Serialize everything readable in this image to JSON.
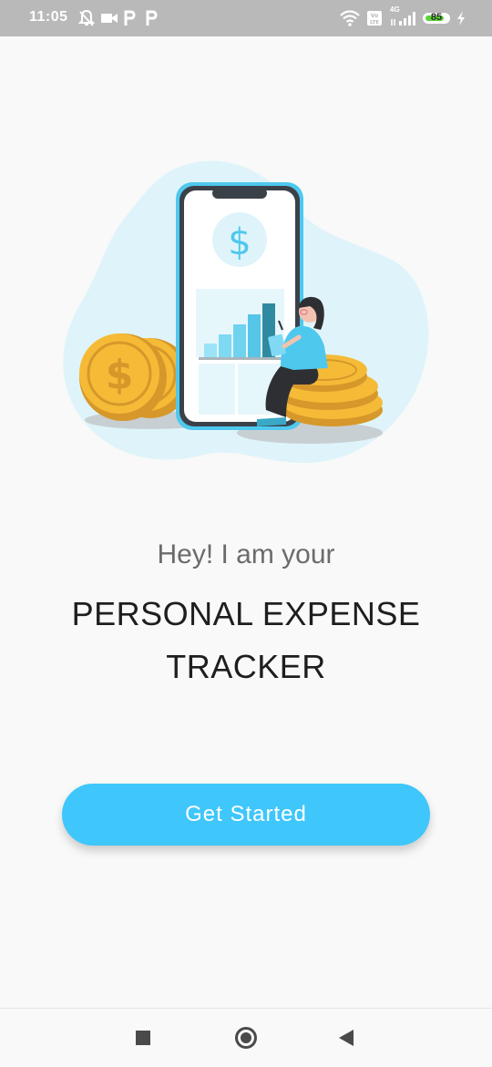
{
  "status_bar": {
    "time": "11:05",
    "icons": [
      "muted-bell-icon",
      "video-icon",
      "p-icon",
      "p-icon",
      "wifi-icon",
      "volte-icon",
      "signal-4g-icon",
      "charging-icon"
    ],
    "network_label": "4G",
    "battery_percent": "85",
    "battery_level": 0.85
  },
  "illustration": {
    "icon": "expense-tracker-illustration",
    "colors": {
      "blob": "#dff4fa",
      "phone_frame": "#4fc8ee",
      "phone_body": "#3b4148",
      "coin_gold": "#f5bb37",
      "coin_dark": "#d6982a",
      "bar_light": "#9be3f7",
      "bar_dark": "#2f8aa1"
    }
  },
  "hero": {
    "greeting": "Hey! I am your",
    "title_line1": "PERSONAL EXPENSE",
    "title_line2": "TRACKER"
  },
  "actions": {
    "get_started_label": "Get Started",
    "button_color": "#3fc6fb"
  },
  "nav_bar": {
    "icons": [
      "recents-icon",
      "home-icon",
      "back-icon"
    ]
  }
}
